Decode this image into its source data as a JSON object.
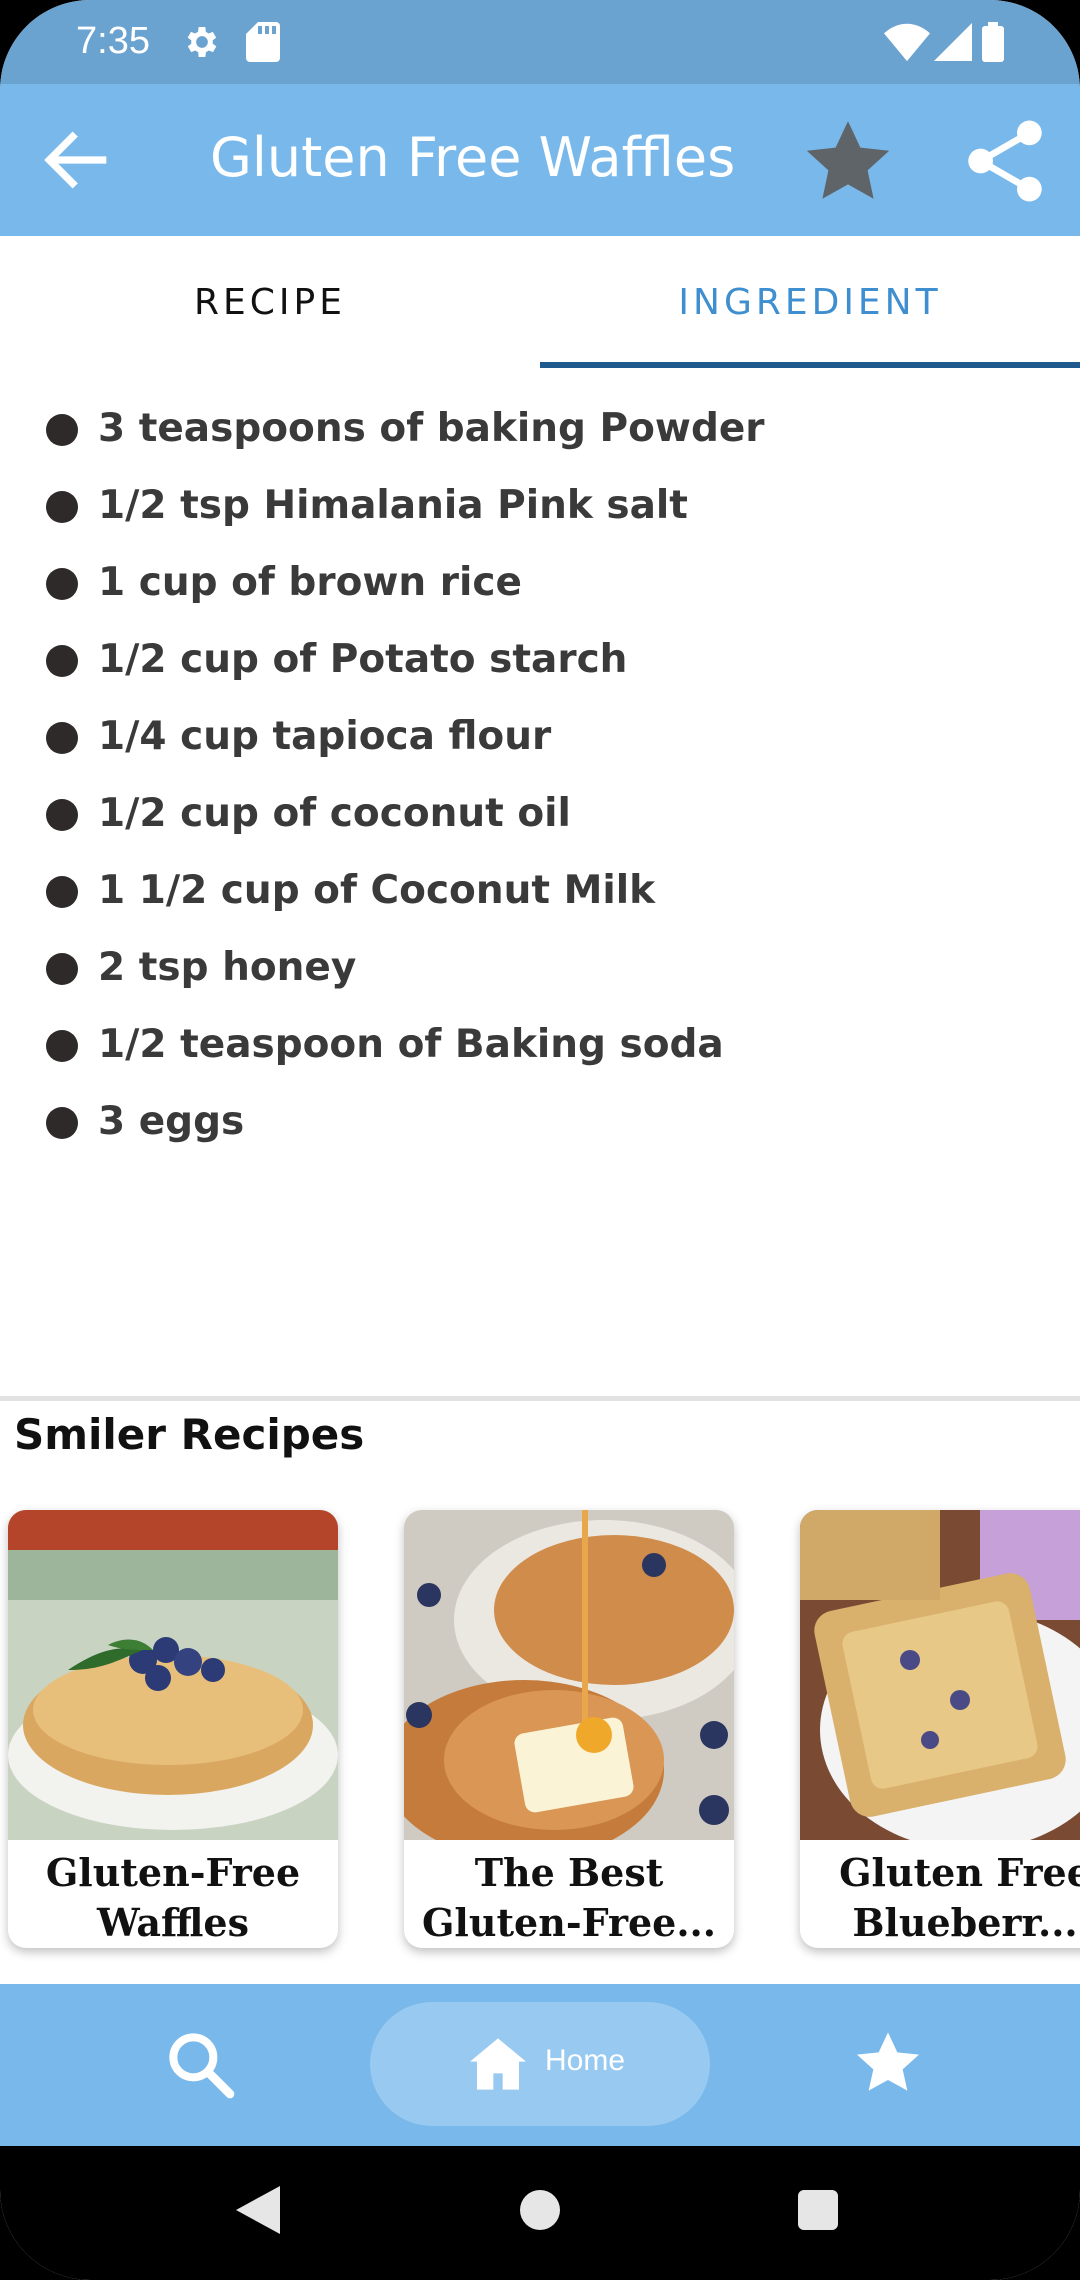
{
  "status_bar": {
    "time": "7:35",
    "icons": [
      "settings-icon",
      "sd-card-icon",
      "wifi-icon",
      "signal-icon",
      "battery-icon"
    ]
  },
  "app_bar": {
    "title": "Gluten Free Waffles",
    "back_icon": "arrow-left-icon",
    "favorite_icon": "star-icon",
    "share_icon": "share-icon"
  },
  "tabs": [
    {
      "label": "RECIPE",
      "selected": false
    },
    {
      "label": "INGREDIENT",
      "selected": true
    }
  ],
  "ingredients": [
    "3 teaspoons of baking Powder",
    "1/2 tsp Himalania Pink salt",
    "1 cup of brown rice",
    "1/2 cup of Potato starch",
    "1/4 cup tapioca flour",
    "1/2 cup of coconut oil",
    "1 1/2 cup of Coconut Milk",
    "2 tsp honey",
    "1/2 teaspoon of Baking soda",
    "3 eggs"
  ],
  "similar": {
    "title": "Smiler Recipes",
    "cards": [
      {
        "title_line1": "Gluten-Free",
        "title_line2": "Waffles"
      },
      {
        "title_line1": "The Best",
        "title_line2": "Gluten-Free..."
      },
      {
        "title_line1": "Gluten Free",
        "title_line2": "Blueberr..."
      }
    ]
  },
  "bottom_nav": {
    "items": [
      {
        "icon": "search-icon",
        "label": ""
      },
      {
        "icon": "home-icon",
        "label": "Home",
        "selected": true
      },
      {
        "icon": "star-icon",
        "label": ""
      }
    ]
  },
  "colors": {
    "status_bar": "#6aa2d0",
    "app_bar": "#78b8ea",
    "tab_selected": "#3f8fd0",
    "tab_indicator": "#1f5a8e",
    "nav_pill": "#98c9f0"
  }
}
